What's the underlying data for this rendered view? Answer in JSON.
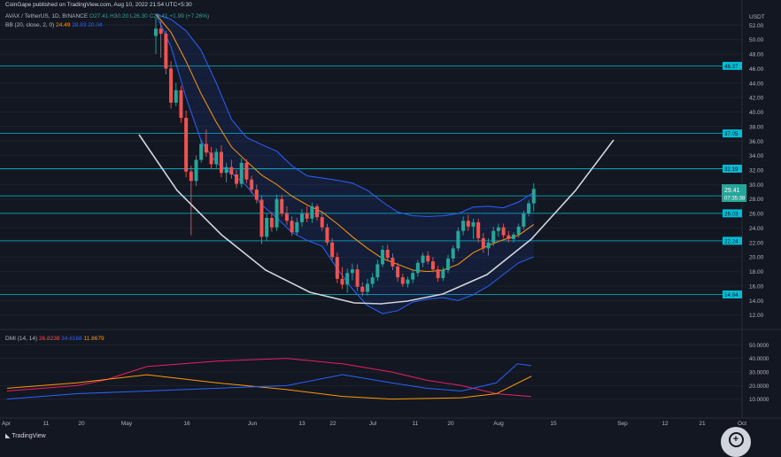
{
  "publisher_line": "CoinGape published on TradingView.com, Aug 10, 2022 21:54 UTC+5:30",
  "legend": {
    "symbol": "AVAX / TetherUS, 1D, BINANCE",
    "ohlc": "O27.41 H30.20 L26.30 C29.41 +1.99 (+7.26%)",
    "bb_label": "BB (20, close, 2, 0)",
    "bb_basis": "24.49",
    "bb_upper": "28.93",
    "bb_lower": "20.04",
    "dmi_label": "DMI (14, 14)",
    "dmi_plus": "26.8238",
    "dmi_minus": "34.6168",
    "dmi_adx": "11.8679"
  },
  "price_label": {
    "price": "29.41",
    "countdown": "07:35:38"
  },
  "footer": {
    "brand": "TradingView"
  },
  "colors": {
    "background": "#131722",
    "up": "#26a69a",
    "down": "#ef5350",
    "level": "#00bcd4",
    "bb_band": "#2962ff",
    "bb_basis": "#ff9800",
    "arc": "#d1d4dc",
    "dmi_plus": "#ff9800",
    "dmi_minus": "#2962ff",
    "adx": "#e91e63"
  },
  "chart_data": {
    "type": "candlestick",
    "quote_currency": "USDT",
    "y_ticks": [
      12,
      14,
      16,
      18,
      20,
      22,
      24,
      26,
      28,
      30,
      32,
      34,
      36,
      38,
      40,
      42,
      44,
      46,
      48,
      50,
      52
    ],
    "ylim": [
      10.5,
      53.5
    ],
    "x_ticks": [
      "Apr",
      "11",
      "20",
      "May",
      "16",
      "Jun",
      "13",
      "22",
      "Jul",
      "11",
      "20",
      "Aug",
      "15",
      "Sep",
      "12",
      "21",
      "Oct"
    ],
    "horizontal_levels": [
      "14.84",
      "22.24",
      "26.03",
      "28.44",
      "32.19",
      "37.05",
      "46.37"
    ],
    "candles": [
      {
        "o": 50.5,
        "h": 53.0,
        "l": 48.0,
        "c": 51.5
      },
      {
        "o": 51.5,
        "h": 52.5,
        "l": 47.5,
        "c": 50.8
      },
      {
        "o": 50.8,
        "h": 51.2,
        "l": 45.2,
        "c": 46.0
      },
      {
        "o": 46.0,
        "h": 47.0,
        "l": 40.5,
        "c": 41.3
      },
      {
        "o": 41.3,
        "h": 44.0,
        "l": 40.8,
        "c": 43.0
      },
      {
        "o": 43.0,
        "h": 43.6,
        "l": 38.5,
        "c": 39.2
      },
      {
        "o": 39.2,
        "h": 40.2,
        "l": 31.0,
        "c": 31.8
      },
      {
        "o": 31.8,
        "h": 32.6,
        "l": 23.0,
        "c": 30.5
      },
      {
        "o": 30.5,
        "h": 34.0,
        "l": 29.8,
        "c": 33.4
      },
      {
        "o": 33.4,
        "h": 36.2,
        "l": 33.0,
        "c": 35.6
      },
      {
        "o": 35.6,
        "h": 37.6,
        "l": 33.8,
        "c": 34.4
      },
      {
        "o": 34.4,
        "h": 35.2,
        "l": 32.2,
        "c": 32.8
      },
      {
        "o": 32.8,
        "h": 35.0,
        "l": 32.3,
        "c": 34.5
      },
      {
        "o": 34.5,
        "h": 35.4,
        "l": 31.0,
        "c": 31.6
      },
      {
        "o": 31.6,
        "h": 33.0,
        "l": 30.3,
        "c": 32.4
      },
      {
        "o": 32.4,
        "h": 33.4,
        "l": 30.8,
        "c": 31.4
      },
      {
        "o": 31.4,
        "h": 32.0,
        "l": 29.5,
        "c": 30.1
      },
      {
        "o": 30.1,
        "h": 33.6,
        "l": 29.6,
        "c": 33.0
      },
      {
        "o": 33.0,
        "h": 33.5,
        "l": 30.2,
        "c": 30.7
      },
      {
        "o": 30.7,
        "h": 31.2,
        "l": 28.8,
        "c": 29.3
      },
      {
        "o": 29.3,
        "h": 30.0,
        "l": 27.4,
        "c": 27.9
      },
      {
        "o": 27.9,
        "h": 28.5,
        "l": 21.8,
        "c": 22.8
      },
      {
        "o": 22.8,
        "h": 26.0,
        "l": 22.3,
        "c": 25.4
      },
      {
        "o": 25.4,
        "h": 26.2,
        "l": 23.5,
        "c": 24.1
      },
      {
        "o": 24.1,
        "h": 28.6,
        "l": 23.6,
        "c": 28.0
      },
      {
        "o": 28.0,
        "h": 28.6,
        "l": 25.6,
        "c": 26.0
      },
      {
        "o": 26.0,
        "h": 27.0,
        "l": 24.4,
        "c": 25.0
      },
      {
        "o": 25.0,
        "h": 25.6,
        "l": 22.9,
        "c": 23.4
      },
      {
        "o": 23.4,
        "h": 25.4,
        "l": 23.0,
        "c": 24.8
      },
      {
        "o": 24.8,
        "h": 26.6,
        "l": 24.2,
        "c": 26.0
      },
      {
        "o": 26.0,
        "h": 27.0,
        "l": 24.8,
        "c": 25.3
      },
      {
        "o": 25.3,
        "h": 27.5,
        "l": 24.7,
        "c": 27.0
      },
      {
        "o": 27.0,
        "h": 27.3,
        "l": 25.0,
        "c": 25.5
      },
      {
        "o": 25.5,
        "h": 26.0,
        "l": 23.6,
        "c": 24.1
      },
      {
        "o": 24.1,
        "h": 24.6,
        "l": 21.6,
        "c": 22.0
      },
      {
        "o": 22.0,
        "h": 22.6,
        "l": 19.6,
        "c": 20.0
      },
      {
        "o": 20.0,
        "h": 20.6,
        "l": 16.4,
        "c": 17.0
      },
      {
        "o": 17.0,
        "h": 18.6,
        "l": 15.6,
        "c": 16.2
      },
      {
        "o": 16.2,
        "h": 18.4,
        "l": 15.1,
        "c": 17.8
      },
      {
        "o": 17.8,
        "h": 19.1,
        "l": 16.8,
        "c": 18.3
      },
      {
        "o": 18.3,
        "h": 19.0,
        "l": 15.3,
        "c": 15.9
      },
      {
        "o": 15.9,
        "h": 16.5,
        "l": 14.6,
        "c": 15.2
      },
      {
        "o": 15.2,
        "h": 17.0,
        "l": 14.7,
        "c": 16.3
      },
      {
        "o": 16.3,
        "h": 17.8,
        "l": 15.8,
        "c": 17.2
      },
      {
        "o": 17.2,
        "h": 19.6,
        "l": 16.7,
        "c": 19.0
      },
      {
        "o": 19.0,
        "h": 21.6,
        "l": 18.6,
        "c": 21.0
      },
      {
        "o": 21.0,
        "h": 21.7,
        "l": 19.4,
        "c": 19.9
      },
      {
        "o": 19.9,
        "h": 20.5,
        "l": 18.2,
        "c": 18.7
      },
      {
        "o": 18.7,
        "h": 19.2,
        "l": 16.6,
        "c": 17.2
      },
      {
        "o": 17.2,
        "h": 17.7,
        "l": 15.9,
        "c": 16.3
      },
      {
        "o": 16.3,
        "h": 17.3,
        "l": 15.8,
        "c": 16.9
      },
      {
        "o": 16.9,
        "h": 18.3,
        "l": 16.4,
        "c": 17.8
      },
      {
        "o": 17.8,
        "h": 19.6,
        "l": 17.3,
        "c": 19.2
      },
      {
        "o": 19.2,
        "h": 20.6,
        "l": 18.6,
        "c": 20.2
      },
      {
        "o": 20.2,
        "h": 20.8,
        "l": 19.0,
        "c": 19.4
      },
      {
        "o": 19.4,
        "h": 20.0,
        "l": 17.9,
        "c": 18.3
      },
      {
        "o": 18.3,
        "h": 18.8,
        "l": 16.6,
        "c": 17.1
      },
      {
        "o": 17.1,
        "h": 18.6,
        "l": 16.7,
        "c": 18.2
      },
      {
        "o": 18.2,
        "h": 20.3,
        "l": 17.8,
        "c": 19.8
      },
      {
        "o": 19.8,
        "h": 21.6,
        "l": 19.3,
        "c": 21.2
      },
      {
        "o": 21.2,
        "h": 24.1,
        "l": 20.8,
        "c": 23.6
      },
      {
        "o": 23.6,
        "h": 25.6,
        "l": 23.0,
        "c": 25.0
      },
      {
        "o": 25.0,
        "h": 25.8,
        "l": 23.6,
        "c": 24.2
      },
      {
        "o": 24.2,
        "h": 25.3,
        "l": 22.5,
        "c": 24.8
      },
      {
        "o": 24.8,
        "h": 25.3,
        "l": 22.0,
        "c": 22.6
      },
      {
        "o": 22.6,
        "h": 23.3,
        "l": 20.6,
        "c": 21.2
      },
      {
        "o": 21.2,
        "h": 22.6,
        "l": 20.2,
        "c": 22.0
      },
      {
        "o": 22.0,
        "h": 24.2,
        "l": 21.5,
        "c": 23.6
      },
      {
        "o": 23.6,
        "h": 24.6,
        "l": 22.8,
        "c": 24.1
      },
      {
        "o": 24.1,
        "h": 24.6,
        "l": 22.6,
        "c": 23.0
      },
      {
        "o": 23.0,
        "h": 23.6,
        "l": 22.0,
        "c": 22.5
      },
      {
        "o": 22.5,
        "h": 23.4,
        "l": 22.0,
        "c": 23.1
      },
      {
        "o": 23.1,
        "h": 24.6,
        "l": 22.7,
        "c": 24.2
      },
      {
        "o": 24.2,
        "h": 26.4,
        "l": 23.8,
        "c": 26.0
      },
      {
        "o": 26.0,
        "h": 27.8,
        "l": 25.6,
        "c": 27.4
      },
      {
        "o": 27.4,
        "h": 30.2,
        "l": 26.3,
        "c": 29.41
      }
    ],
    "bollinger": {
      "upper": [
        [
          0,
          53.5
        ],
        [
          3,
          52.8
        ],
        [
          6,
          51.2
        ],
        [
          9,
          48.5
        ],
        [
          12,
          44.0
        ],
        [
          15,
          39.0
        ],
        [
          18,
          36.5
        ],
        [
          21,
          35.5
        ],
        [
          24,
          34.6
        ],
        [
          27,
          32.6
        ],
        [
          30,
          31.2
        ],
        [
          33,
          30.9
        ],
        [
          36,
          30.6
        ],
        [
          39,
          30.2
        ],
        [
          42,
          29.2
        ],
        [
          45,
          27.6
        ],
        [
          48,
          26.2
        ],
        [
          51,
          25.7
        ],
        [
          54,
          25.6
        ],
        [
          57,
          25.7
        ],
        [
          60,
          26.0
        ],
        [
          63,
          26.9
        ],
        [
          66,
          27.0
        ],
        [
          69,
          26.8
        ],
        [
          72,
          27.6
        ],
        [
          75,
          28.93
        ]
      ],
      "basis": [
        [
          0,
          53.5
        ],
        [
          3,
          51.0
        ],
        [
          6,
          47.0
        ],
        [
          9,
          42.5
        ],
        [
          12,
          38.6
        ],
        [
          15,
          35.2
        ],
        [
          18,
          33.2
        ],
        [
          21,
          31.3
        ],
        [
          24,
          30.0
        ],
        [
          27,
          28.4
        ],
        [
          30,
          27.2
        ],
        [
          33,
          26.2
        ],
        [
          36,
          24.6
        ],
        [
          39,
          22.8
        ],
        [
          42,
          21.2
        ],
        [
          45,
          19.8
        ],
        [
          48,
          19.0
        ],
        [
          51,
          18.2
        ],
        [
          54,
          18.0
        ],
        [
          57,
          18.2
        ],
        [
          60,
          19.0
        ],
        [
          63,
          20.6
        ],
        [
          66,
          21.6
        ],
        [
          69,
          22.4
        ],
        [
          72,
          23.0
        ],
        [
          75,
          24.49
        ]
      ],
      "lower": [
        [
          0,
          53.5
        ],
        [
          3,
          49.0
        ],
        [
          6,
          42.0
        ],
        [
          9,
          36.0
        ],
        [
          12,
          33.0
        ],
        [
          15,
          31.6
        ],
        [
          18,
          29.8
        ],
        [
          21,
          27.2
        ],
        [
          24,
          25.4
        ],
        [
          27,
          23.4
        ],
        [
          30,
          22.3
        ],
        [
          33,
          21.5
        ],
        [
          36,
          18.4
        ],
        [
          39,
          15.6
        ],
        [
          42,
          13.3
        ],
        [
          45,
          12.2
        ],
        [
          48,
          12.6
        ],
        [
          51,
          13.8
        ],
        [
          54,
          14.2
        ],
        [
          57,
          14.4
        ],
        [
          60,
          14.0
        ],
        [
          63,
          14.8
        ],
        [
          66,
          16.0
        ],
        [
          69,
          17.6
        ],
        [
          72,
          19.2
        ],
        [
          75,
          20.04
        ]
      ]
    },
    "arc_annotation": {
      "points": [
        [
          157,
          152
        ],
        [
          200,
          215
        ],
        [
          250,
          265
        ],
        [
          300,
          305
        ],
        [
          350,
          330
        ],
        [
          400,
          342
        ],
        [
          430,
          343
        ],
        [
          460,
          340
        ],
        [
          500,
          332
        ],
        [
          550,
          310
        ],
        [
          600,
          270
        ],
        [
          650,
          215
        ],
        [
          693,
          158
        ]
      ]
    },
    "dmi": {
      "y_ticks": [
        10,
        20,
        30,
        40,
        50
      ],
      "ylim": [
        0,
        60
      ],
      "plus_di": [
        [
          0,
          18
        ],
        [
          10,
          22
        ],
        [
          20,
          28
        ],
        [
          30,
          22
        ],
        [
          40,
          17
        ],
        [
          48,
          12
        ],
        [
          55,
          10
        ],
        [
          65,
          11
        ],
        [
          70,
          14
        ],
        [
          75,
          26.82
        ]
      ],
      "minus_di": [
        [
          0,
          10
        ],
        [
          10,
          14
        ],
        [
          20,
          16
        ],
        [
          30,
          18
        ],
        [
          40,
          20
        ],
        [
          48,
          28
        ],
        [
          55,
          22
        ],
        [
          60,
          18
        ],
        [
          65,
          16
        ],
        [
          70,
          22
        ],
        [
          73,
          36
        ],
        [
          75,
          34.62
        ]
      ],
      "adx": [
        [
          0,
          16
        ],
        [
          10,
          20
        ],
        [
          14,
          24
        ],
        [
          20,
          34
        ],
        [
          30,
          38
        ],
        [
          40,
          40
        ],
        [
          48,
          36
        ],
        [
          55,
          30
        ],
        [
          60,
          24
        ],
        [
          65,
          20
        ],
        [
          70,
          14
        ],
        [
          75,
          11.87
        ]
      ]
    }
  }
}
